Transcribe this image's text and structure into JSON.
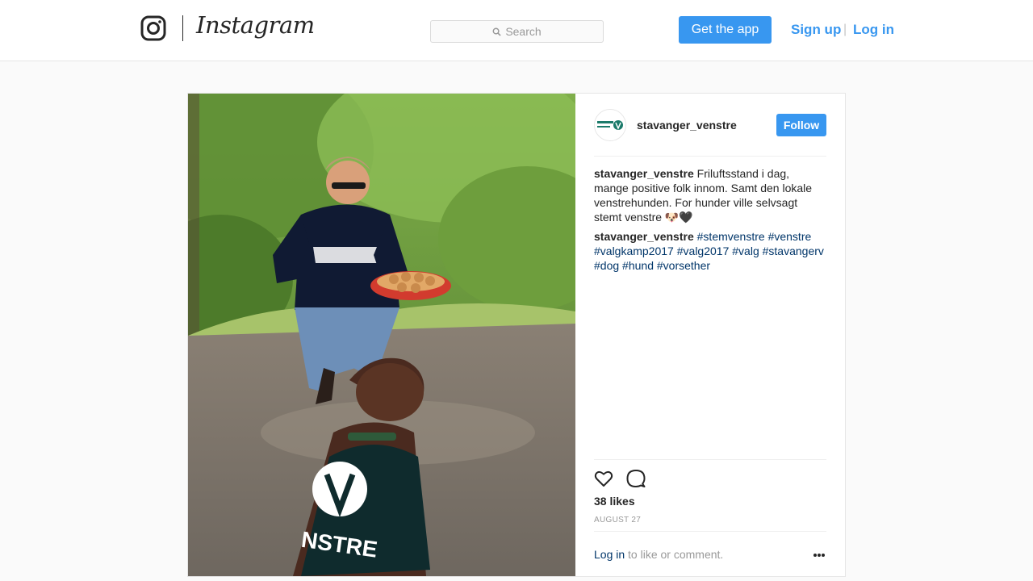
{
  "nav": {
    "wordmark": "Instagram",
    "search_placeholder": "Search",
    "get_app": "Get the app",
    "sign_up": "Sign up",
    "separator": "|",
    "log_in": "Log in",
    "icons": [
      "instagram-glyph-icon",
      "search-icon"
    ],
    "accent_color": "#3897f0"
  },
  "post": {
    "username": "stavanger_venstre",
    "follow_label": "Follow",
    "avatar_icon": "venstre-logo-avatar",
    "caption": {
      "username": "stavanger_venstre",
      "text": "Friluftsstand i dag, mange positive folk innom. Samt den lokale venstrehunden. For hunder ville selvsagt stemt venstre 🐶🖤"
    },
    "hashtag_comment": {
      "username": "stavanger_venstre",
      "tags": [
        "#stemvenstre",
        "#venstre",
        "#valgkamp2017",
        "#valg2017",
        "#valg",
        "#stavangerv",
        "#dog",
        "#hund",
        "#vorsether"
      ]
    },
    "likes": "38 likes",
    "date": "AUGUST 27",
    "login_link": "Log in",
    "login_suffix": " to like or comment.",
    "action_icons": [
      "heart-icon",
      "comment-icon",
      "more-options-icon"
    ]
  }
}
